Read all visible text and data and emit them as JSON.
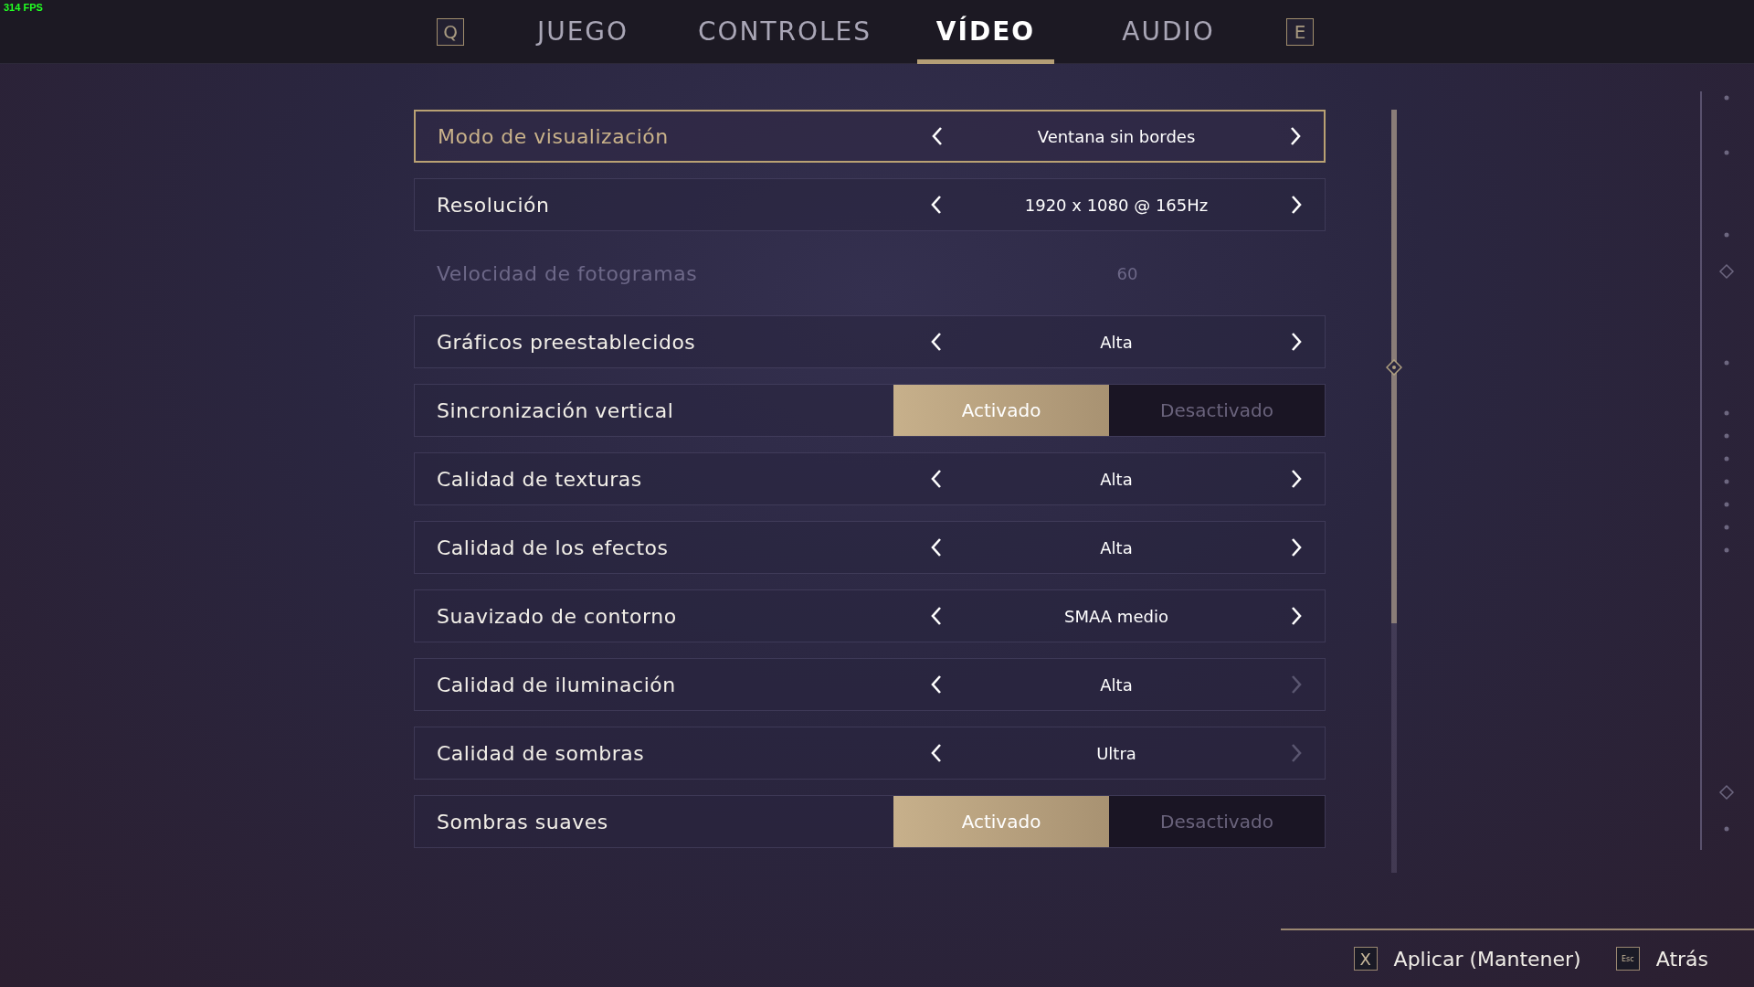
{
  "fps_counter": "314 FPS",
  "tabs": {
    "prev_key": "Q",
    "next_key": "E",
    "items": [
      {
        "label": "JUEGO",
        "selected": false
      },
      {
        "label": "CONTROLES",
        "selected": false
      },
      {
        "label": "VÍDEO",
        "selected": true
      },
      {
        "label": "AUDIO",
        "selected": false
      }
    ]
  },
  "settings": [
    {
      "kind": "selector",
      "label": "Modo de visualización",
      "value": "Ventana sin bordes",
      "selected": true,
      "prev_enabled": true,
      "next_enabled": true
    },
    {
      "kind": "selector",
      "label": "Resolución",
      "value": "1920 x 1080 @ 165Hz",
      "selected": false,
      "prev_enabled": true,
      "next_enabled": true
    },
    {
      "kind": "readonly",
      "label": "Velocidad de fotogramas",
      "value": "60",
      "selected": false
    },
    {
      "kind": "selector",
      "label": "Gráficos preestablecidos",
      "value": "Alta",
      "selected": false,
      "prev_enabled": true,
      "next_enabled": true
    },
    {
      "kind": "toggle",
      "label": "Sincronización vertical",
      "selected": false,
      "options": [
        {
          "label": "Activado",
          "selected": true
        },
        {
          "label": "Desactivado",
          "selected": false
        }
      ]
    },
    {
      "kind": "selector",
      "label": "Calidad de texturas",
      "value": "Alta",
      "selected": false,
      "prev_enabled": true,
      "next_enabled": true
    },
    {
      "kind": "selector",
      "label": "Calidad de los efectos",
      "value": "Alta",
      "selected": false,
      "prev_enabled": true,
      "next_enabled": true
    },
    {
      "kind": "selector",
      "label": "Suavizado de contorno",
      "value": "SMAA medio",
      "selected": false,
      "prev_enabled": true,
      "next_enabled": true
    },
    {
      "kind": "selector",
      "label": "Calidad de iluminación",
      "value": "Alta",
      "selected": false,
      "prev_enabled": true,
      "next_enabled": false
    },
    {
      "kind": "selector",
      "label": "Calidad de sombras",
      "value": "Ultra",
      "selected": false,
      "prev_enabled": true,
      "next_enabled": false
    },
    {
      "kind": "toggle",
      "label": "Sombras suaves",
      "selected": false,
      "options": [
        {
          "label": "Activado",
          "selected": true
        },
        {
          "label": "Desactivado",
          "selected": false
        }
      ]
    }
  ],
  "hints": [
    {
      "key": "X",
      "label": "Aplicar (Mantener)"
    },
    {
      "key": "Esc",
      "label": "Atrás"
    }
  ]
}
